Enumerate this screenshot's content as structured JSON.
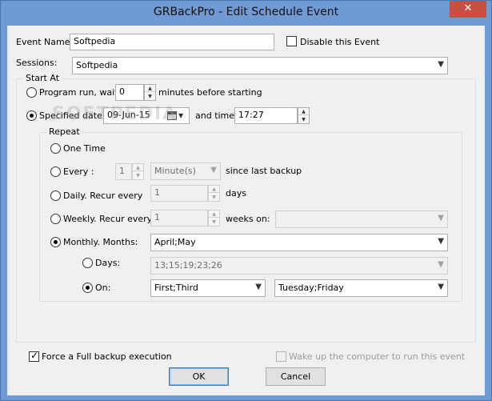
{
  "window": {
    "title": "GRBackPro - Edit Schedule Event",
    "close_glyph": "✕"
  },
  "event_name": {
    "label": "Event Name:",
    "value": "Softpedia"
  },
  "disable_event": {
    "label": "Disable this Event",
    "checked": false
  },
  "sessions": {
    "label": "Sessions:",
    "value": "Softpedia"
  },
  "start_at": {
    "legend": "Start At",
    "program_run": {
      "label": "Program run, wait:",
      "value": "0",
      "suffix": "minutes before starting",
      "selected": false
    },
    "specified_date": {
      "label": "Specified date:",
      "date_value": "09-Jun-15",
      "time_label": "and time:",
      "time_value": "17:27",
      "selected": true
    }
  },
  "repeat": {
    "legend": "Repeat",
    "one_time": {
      "label": "One Time",
      "selected": false
    },
    "every": {
      "label": "Every :",
      "value": "1",
      "unit": "Minute(s)",
      "suffix": "since last backup",
      "selected": false
    },
    "daily": {
      "label": "Daily. Recur every",
      "value": "1",
      "suffix": "days",
      "selected": false
    },
    "weekly": {
      "label": "Weekly. Recur every",
      "value": "1",
      "suffix": "weeks on:",
      "days_value": "",
      "selected": false
    },
    "monthly": {
      "label": "Monthly. Months:",
      "months_value": "April;May",
      "selected": true,
      "days": {
        "label": "Days:",
        "value": "13;15;19;23;26",
        "selected": false
      },
      "on": {
        "label": "On:",
        "ordinal_value": "First;Third",
        "weekday_value": "Tuesday;Friday",
        "selected": true
      }
    }
  },
  "force_full_backup": {
    "label": "Force a Full backup execution",
    "checked": true
  },
  "wake_up": {
    "label": "Wake up the computer to run this event",
    "checked": false
  },
  "buttons": {
    "ok": "OK",
    "cancel": "Cancel"
  },
  "watermark": "SOFTPEDIA"
}
